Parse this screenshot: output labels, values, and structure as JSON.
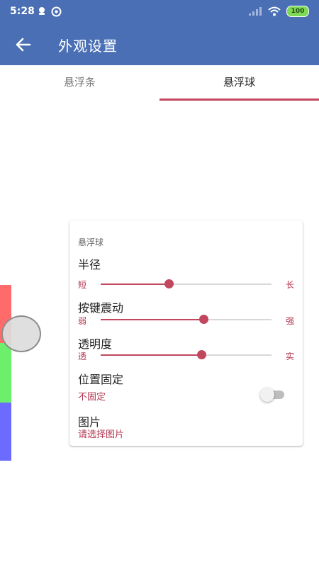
{
  "status_bar": {
    "time": "5:28",
    "battery": "100"
  },
  "app_bar": {
    "title": "外观设置"
  },
  "tabs": [
    {
      "label": "悬浮条",
      "selected": false
    },
    {
      "label": "悬浮球",
      "selected": true
    }
  ],
  "preview": {
    "colors": [
      "#ff6a6a",
      "#6cf06c",
      "#6b6bff"
    ]
  },
  "card": {
    "title": "悬浮球",
    "radius": {
      "label": "半径",
      "min_label": "短",
      "max_label": "长",
      "value": 0.4
    },
    "vibration": {
      "label": "按键震动",
      "min_label": "弱",
      "max_label": "强",
      "value": 0.6
    },
    "opacity": {
      "label": "透明度",
      "min_label": "透",
      "max_label": "实",
      "value": 0.59
    },
    "fixed_position": {
      "label": "位置固定",
      "status": "不固定",
      "on": false
    },
    "image": {
      "label": "图片",
      "hint": "请选择图片"
    }
  },
  "colors": {
    "primary": "#4a6fb5",
    "accent": "#c2475e"
  }
}
